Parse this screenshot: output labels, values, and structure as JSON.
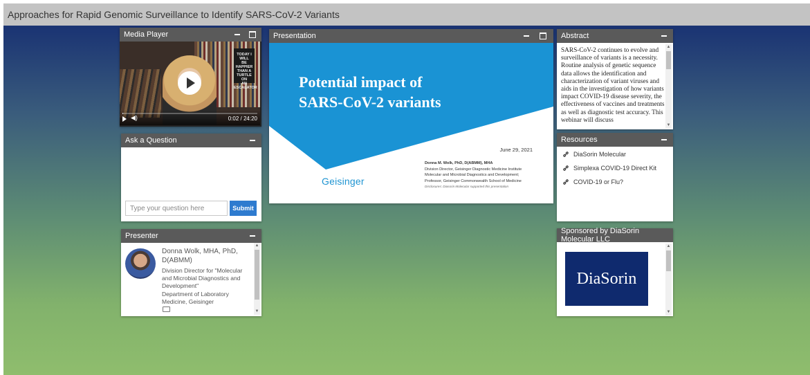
{
  "page": {
    "title": "Approaches for Rapid Genomic Surveillance to Identify SARS-CoV-2 Variants"
  },
  "media_player": {
    "title": "Media Player",
    "time": "0:02 / 24:20",
    "progress_fraction": 0.001,
    "sign_text": "TODAY I WILL BE HAPPIER THAN A TURTLE ON AN ESCALATOR"
  },
  "ask": {
    "title": "Ask a Question",
    "placeholder": "Type your question here",
    "submit_label": "Submit"
  },
  "presenter": {
    "title": "Presenter",
    "name": "Donna Wolk, MHA, PhD, D(ABMM)",
    "role": "Division Director for \"Molecular and Microbial Diagnostics and Development\"",
    "dept": "Department of Laboratory Medicine, Geisinger"
  },
  "presentation": {
    "title": "Presentation",
    "slide_title_line1": "Potential impact of",
    "slide_title_line2": "SARS-CoV-2 variants",
    "date": "June 29, 2021",
    "presenter_line": "Donna M. Wolk, PhD, D(ABMM), MHA",
    "role_line1": "Division Director, Geisinger Diagnostic Medicine Institute",
    "role_line2": "Molecular and Microbial Diagnostics and Development;",
    "role_line3": "Professor, Geisinger Commonwealth School of Medicine",
    "disclosure": "Disclosures: Diasorin Molecular supported this presentation",
    "logo": "Geisinger",
    "colors": {
      "slide_blue": "#1a93d4"
    }
  },
  "abstract": {
    "title": "Abstract",
    "text": "SARS-CoV-2 continues to evolve and surveillance of variants is a necessity. Routine analysis of genetic sequence data allows the identification and characterization of variant viruses and aids in the investigation of how variants impact COVID-19 disease severity, the effectiveness of vaccines and treatments as well as diagnostic test accuracy. This webinar will discuss"
  },
  "resources": {
    "title": "Resources",
    "items": [
      {
        "label": "DiaSorin Molecular"
      },
      {
        "label": "Simplexa COVID-19 Direct Kit"
      },
      {
        "label": "COVID-19 or Flu?"
      }
    ]
  },
  "sponsor": {
    "title": "Sponsored by DiaSorin Molecular LLC",
    "logo_text": "DiaSorin"
  }
}
